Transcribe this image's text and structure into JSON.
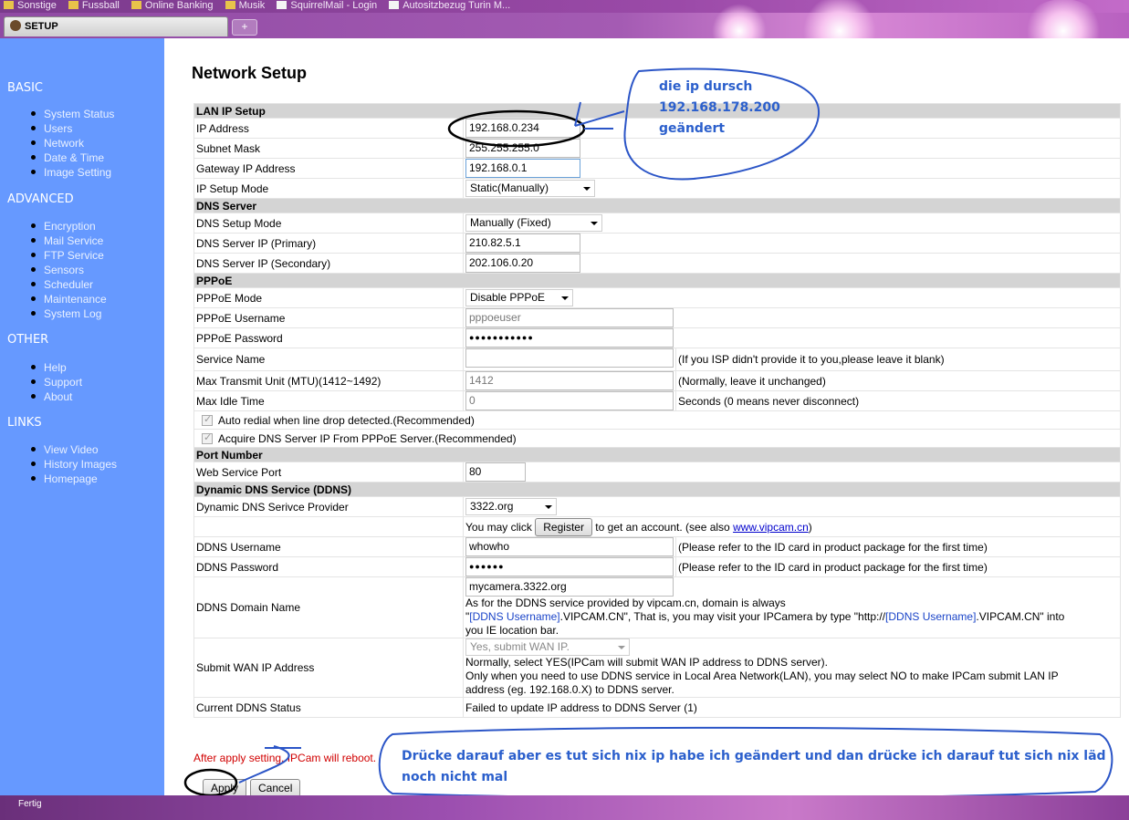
{
  "browser": {
    "bookmarks": [
      "Sonstige",
      "Fussball",
      "Online Banking",
      "Musik",
      "SquirrelMail - Login",
      "Autositzbezug Turin M..."
    ],
    "tab_label": "SETUP",
    "new_tab_label": "+",
    "status_text": "Fertig"
  },
  "sidebar": {
    "sections": [
      {
        "heading": "BASIC",
        "items": [
          "System Status",
          "Users",
          "Network",
          "Date & Time",
          "Image Setting"
        ]
      },
      {
        "heading": "ADVANCED",
        "items": [
          "Encryption",
          "Mail Service",
          "FTP Service",
          "Sensors",
          "Scheduler",
          "Maintenance",
          "System Log"
        ]
      },
      {
        "heading": "OTHER",
        "items": [
          "Help",
          "Support",
          "About"
        ]
      },
      {
        "heading": "LINKS",
        "items": [
          "View Video",
          "History Images",
          "Homepage"
        ]
      }
    ]
  },
  "main": {
    "title": "Network Setup",
    "lan": {
      "section": "LAN IP Setup",
      "ip_label": "IP Address",
      "ip_value": "192.168.0.234",
      "subnet_label": "Subnet Mask",
      "subnet_value": "255.255.255.0",
      "gateway_label": "Gateway IP Address",
      "gateway_value": "192.168.0.1",
      "mode_label": "IP Setup Mode",
      "mode_value": "Static(Manually)"
    },
    "dns": {
      "section": "DNS Server",
      "mode_label": "DNS Setup Mode",
      "mode_value": "Manually (Fixed)",
      "primary_label": "DNS Server IP (Primary)",
      "primary_value": "210.82.5.1",
      "secondary_label": "DNS Server IP (Secondary)",
      "secondary_value": "202.106.0.20"
    },
    "pppoe": {
      "section": "PPPoE",
      "mode_label": "PPPoE Mode",
      "mode_value": "Disable PPPoE",
      "user_label": "PPPoE Username",
      "user_value": "pppoeuser",
      "pass_label": "PPPoE Password",
      "pass_value": "●●●●●●●●●●●",
      "service_label": "Service Name",
      "service_value": "",
      "service_note": "(If you ISP didn't provide it to you,please leave it blank)",
      "mtu_label": "Max Transmit Unit (MTU)(1412~1492)",
      "mtu_value": "1412",
      "mtu_note": "(Normally, leave it unchanged)",
      "idle_label": "Max Idle Time",
      "idle_value": "0",
      "idle_note": "Seconds (0 means never disconnect)",
      "auto_redial": "Auto redial when line drop detected.(Recommended)",
      "acquire_dns": "Acquire DNS Server IP From PPPoE Server.(Recommended)"
    },
    "port": {
      "section": "Port Number",
      "web_label": "Web Service Port",
      "web_value": "80"
    },
    "ddns": {
      "section": "Dynamic DNS Service (DDNS)",
      "provider_label": "Dynamic DNS Serivce Provider",
      "provider_value": "3322.org",
      "register_pre": "You may click",
      "register_button": "Register",
      "register_post": "to get an account. (see also",
      "register_link": "www.vipcam.cn",
      "register_close": ")",
      "user_label": "DDNS Username",
      "user_value": "whowho",
      "user_note": "(Please refer to the ID card in product package for the first time)",
      "pass_label": "DDNS Password",
      "pass_value": "●●●●●●",
      "pass_note": "(Please refer to the ID card in product package for the first time)",
      "domain_label": "DDNS Domain Name",
      "domain_value": "mycamera.3322.org",
      "domain_text1": "As for the DDNS service provided by vipcam.cn, domain is always",
      "domain_text2a": "\"",
      "domain_text2b": "[DDNS Username]",
      "domain_text2c": ".VIPCAM.CN\", That is, you may visit your IPCamera by type \"http://",
      "domain_text2d": "[DDNS Username]",
      "domain_text2e": ".VIPCAM.CN\" into",
      "domain_text3": "you IE location bar.",
      "wan_label": "Submit WAN IP Address",
      "wan_value": "Yes, submit WAN IP.",
      "wan_text1": "Normally, select YES(IPCam will submit WAN IP address to DDNS server).",
      "wan_text2": "Only when you need to use DDNS service in Local Area Network(LAN), you may select NO to make IPCam submit LAN IP",
      "wan_text3": "address (eg. 192.168.0.X) to DDNS server.",
      "status_label": "Current DDNS Status",
      "status_value": "Failed to update IP address to DDNS Server (1)"
    },
    "reboot_note": "After apply setting, IPCam will reboot.",
    "apply_label": "Apply",
    "cancel_label": "Cancel"
  },
  "annotations": {
    "ip_note_line1": "die ip dursch",
    "ip_note_line2": "192.168.178.200",
    "ip_note_line3": "geändert",
    "apply_note_line1": "Drücke darauf aber es tut sich nix ip habe ich geändert und dan drücke ich darauf tut sich nix läd",
    "apply_note_line2": "noch nicht mal"
  },
  "colors": {
    "sidebar": "#6699ff",
    "section_header": "#d4d4d4",
    "annotation": "#2b5fcc",
    "reboot_note": "#d10000"
  }
}
